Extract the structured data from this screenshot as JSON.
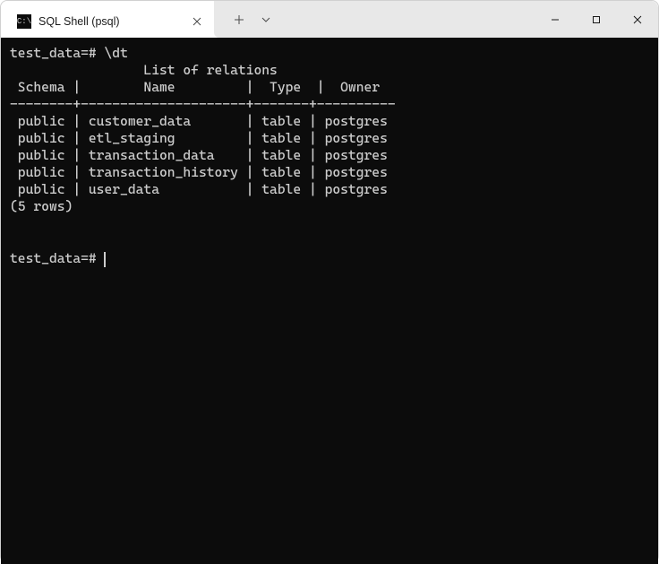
{
  "window": {
    "tab_title": "SQL Shell (psql)"
  },
  "terminal": {
    "prompt": "test_data=#",
    "command": "\\dt",
    "list_header": "List of relations",
    "columns": {
      "c1": "Schema",
      "c2": "Name",
      "c3": "Type",
      "c4": "Owner"
    },
    "separator": "--------+---------------------+-------+----------",
    "rows": [
      {
        "schema": "public",
        "name": "customer_data",
        "type": "table",
        "owner": "postgres"
      },
      {
        "schema": "public",
        "name": "etl_staging",
        "type": "table",
        "owner": "postgres"
      },
      {
        "schema": "public",
        "name": "transaction_data",
        "type": "table",
        "owner": "postgres"
      },
      {
        "schema": "public",
        "name": "transaction_history",
        "type": "table",
        "owner": "postgres"
      },
      {
        "schema": "public",
        "name": "user_data",
        "type": "table",
        "owner": "postgres"
      }
    ],
    "row_count_label": "(5 rows)"
  }
}
